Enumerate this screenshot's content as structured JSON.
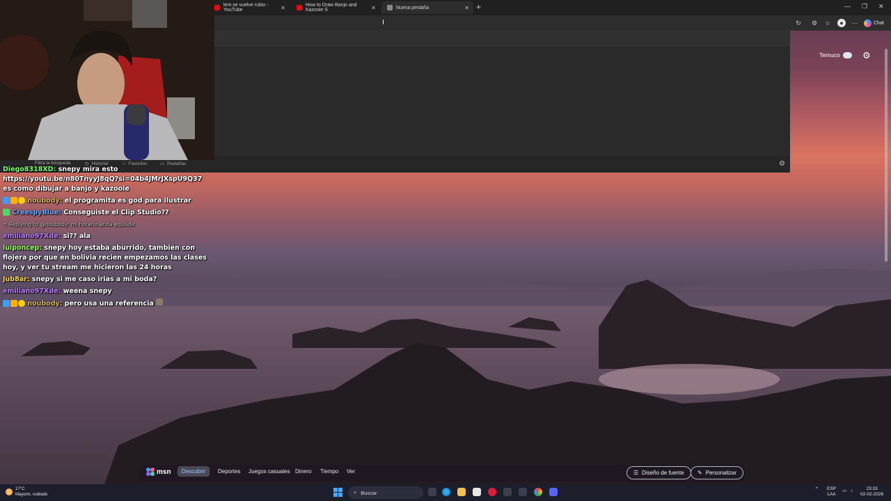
{
  "browser": {
    "tabs": [
      {
        "label": "lem se vuelve rubio - YouTube",
        "favicon_color": "#ff0000",
        "active": false
      },
      {
        "label": "How to Draw Banjo and Kazooie S",
        "favicon_color": "#ff0000",
        "active": false
      },
      {
        "label": "Nueva pestaña",
        "favicon_color": "#8a8a8a",
        "active": true
      }
    ],
    "new_tab_icon": "plus-icon",
    "toolbar": {
      "chat_label": "Chat"
    },
    "dropdown_footer": {
      "search_hint": "Filtra la búsqueda",
      "history": "Historial",
      "favorites": "Favoritos",
      "tabs": "Pestañas"
    }
  },
  "page": {
    "weather_city": "Temuco",
    "msn": {
      "logo": "msn",
      "tabs": [
        "Descubrir",
        "Deportes",
        "Juegos casuales",
        "Dinero",
        "Tiempo",
        "Ver"
      ],
      "active_tab": "Descubrir",
      "font_button": "Diseño de fuente",
      "customize_button": "Personalizar"
    }
  },
  "chat": {
    "messages": [
      {
        "user": "Diego8318XD",
        "user_color": "#7cff6b",
        "badges": [],
        "text": "snepy mira esto https://youtu.be/n80TnyyJ8qQ?si=04b4JMrJXspU9Q37 es como dibujar a banjo y kazooie"
      },
      {
        "user": "noubody",
        "user_color": "#d6b25a",
        "badges": [
          "#3aa0ff",
          "#ffb000",
          "#ffd000"
        ],
        "text": "el programita es god para ilustrar"
      },
      {
        "user": "CreespyBlue",
        "user_color": "#6aa8ff",
        "badges": [
          "#4cd964"
        ],
        "text": "Conseguiste el Clip Studio??"
      },
      {
        "reply": "Replying to @noubody: mi horario anda equisde"
      },
      {
        "user": "emiliano97Xde",
        "user_color": "#b77bff",
        "badges": [],
        "text": "si?? ala"
      },
      {
        "user": "luiponcep",
        "user_color": "#9aff5a",
        "badges": [],
        "text": "snepy hoy estaba aburrido, tambien con flojera por que en bolivia recien empezamos las clases hoy, y ver tu stream me hicieron las 24 horas"
      },
      {
        "user": "Jub8ar",
        "user_color": "#ffd84a",
        "badges": [],
        "text": "snepy si me caso irias a mi boda?"
      },
      {
        "user": "emiliano97Xde",
        "user_color": "#b77bff",
        "badges": [],
        "text": "weena snepy"
      },
      {
        "user": "noubody",
        "user_color": "#d6b25a",
        "badges": [
          "#3aa0ff",
          "#ffb000",
          "#ffd000"
        ],
        "text": "pero usa una referencia"
      }
    ]
  },
  "taskbar": {
    "weather_temp": "17°C",
    "weather_desc": "Mayorm. nublado",
    "search_label": "Buscar",
    "lang_top": "ESP",
    "lang_bottom": "LAA",
    "time": "23:33",
    "date": "02-02-2026"
  }
}
